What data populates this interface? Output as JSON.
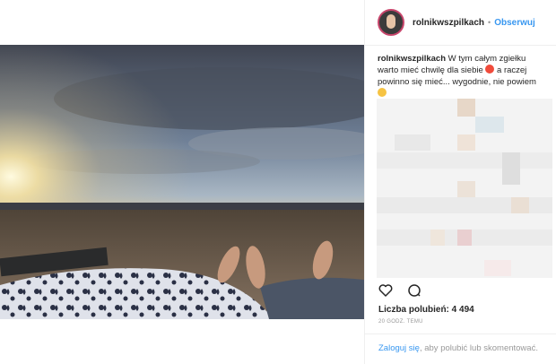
{
  "post": {
    "username": "rolnikwszpilkach",
    "follow_label": "Obserwuj",
    "separator": "•",
    "caption_user": "rolnikwszpilkach",
    "caption_text_1": "W tym całym zgiełku warto mieć chwilę dla siebie",
    "caption_text_2": "a raczej powinno się mieć... wygodnie, nie powiem",
    "likes_text": "Liczba polubień: 4 494",
    "time_text": "20 GODZ. TEMU",
    "login_link": "Zaloguj się",
    "login_rest": ", aby polubić lub skomentować."
  },
  "icons": {
    "like": "heart-icon",
    "comment": "comment-icon"
  },
  "colors": {
    "link": "#3897f0",
    "text": "#262626",
    "muted": "#999999"
  }
}
